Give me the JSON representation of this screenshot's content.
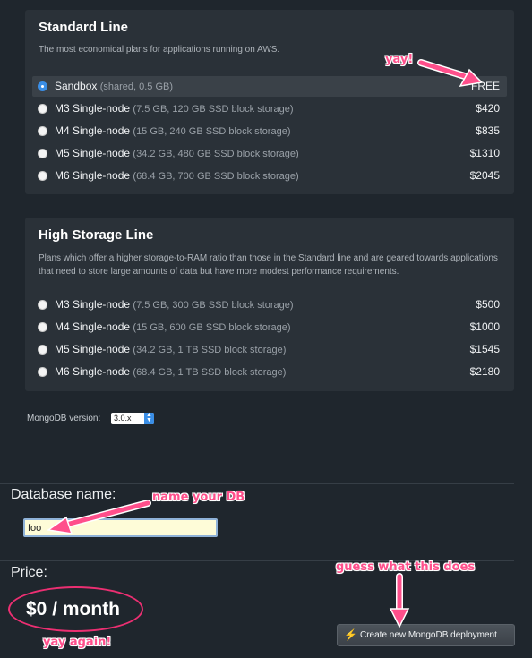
{
  "standard": {
    "title": "Standard Line",
    "description": "The most economical plans for applications running on AWS.",
    "plans": [
      {
        "name": "Sandbox",
        "spec": "(shared, 0.5 GB)",
        "price": "FREE",
        "selected": true
      },
      {
        "name": "M3 Single-node",
        "spec": "(7.5 GB, 120 GB SSD block storage)",
        "price": "$420",
        "selected": false
      },
      {
        "name": "M4 Single-node",
        "spec": "(15 GB, 240 GB SSD block storage)",
        "price": "$835",
        "selected": false
      },
      {
        "name": "M5 Single-node",
        "spec": "(34.2 GB, 480 GB SSD block storage)",
        "price": "$1310",
        "selected": false
      },
      {
        "name": "M6 Single-node",
        "spec": "(68.4 GB, 700 GB SSD block storage)",
        "price": "$2045",
        "selected": false
      }
    ]
  },
  "high_storage": {
    "title": "High Storage Line",
    "description": "Plans which offer a higher storage-to-RAM ratio than those in the Standard line and are geared towards applications that need to store large amounts of data but have more modest performance requirements.",
    "plans": [
      {
        "name": "M3 Single-node",
        "spec": "(7.5 GB, 300 GB SSD block storage)",
        "price": "$500",
        "selected": false
      },
      {
        "name": "M4 Single-node",
        "spec": "(15 GB, 600 GB SSD block storage)",
        "price": "$1000",
        "selected": false
      },
      {
        "name": "M5 Single-node",
        "spec": "(34.2 GB, 1 TB SSD block storage)",
        "price": "$1545",
        "selected": false
      },
      {
        "name": "M6 Single-node",
        "spec": "(68.4 GB, 1 TB SSD block storage)",
        "price": "$2180",
        "selected": false
      }
    ]
  },
  "version": {
    "label": "MongoDB version:",
    "value": "3.0.x"
  },
  "database": {
    "label": "Database name:",
    "value": "foo"
  },
  "price": {
    "label": "Price:",
    "value": "$0 / month"
  },
  "create_button": {
    "label": "Create new MongoDB deployment",
    "icon": "lightning-bolt-icon"
  },
  "annotations": {
    "yay": "yay!",
    "name_db": "name your DB",
    "guess": "guess what this does",
    "yay_again": "yay again!"
  },
  "colors": {
    "annotation": "#ff4f8b",
    "accent": "#3a8ee6",
    "background": "#1f262d",
    "panel": "#2a3138"
  }
}
